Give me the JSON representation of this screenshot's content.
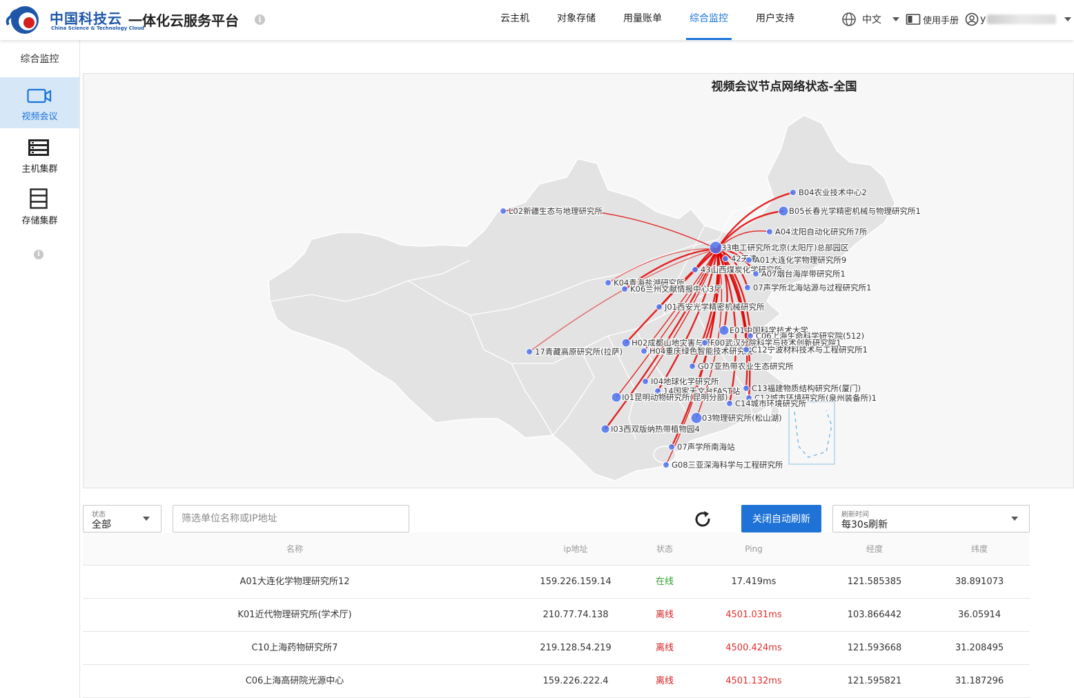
{
  "header": {
    "brand_cn": "中国科技云",
    "brand_en": "China Science & Technology Cloud",
    "platform_title": "一体化云服务平台",
    "nav": [
      {
        "label": "云主机",
        "active": false
      },
      {
        "label": "对象存储",
        "active": false
      },
      {
        "label": "用量账单",
        "active": false
      },
      {
        "label": "综合监控",
        "active": true
      },
      {
        "label": "用户支持",
        "active": false
      }
    ],
    "language": "中文",
    "manual": "使用手册",
    "user_initial": "y"
  },
  "sidebar": {
    "title": "综合监控",
    "items": [
      {
        "label": "视频会议",
        "icon": "video-icon",
        "active": true
      },
      {
        "label": "主机集群",
        "icon": "server-icon",
        "active": false
      },
      {
        "label": "存储集群",
        "icon": "storage-icon",
        "active": false
      }
    ]
  },
  "map": {
    "title": "视频会议节点网络状态-全国",
    "labels": [
      "L02新疆生态与地理研究所",
      "B04农业技术中心2",
      "B05长春光学精密机械与物理研究所1",
      "A04沈阳自动化研究所7所",
      "33电工研究所北京(太阳厅)总部园区",
      "42天津",
      "A01大连化学物理研究所9",
      "43山西煤炭化学研究所",
      "A07烟台海岸带研究所1",
      "K04青海盐湖研究所",
      "K06兰州文献情报中心3厅",
      "07声学所北海站源与过程研究所1",
      "J01西安光学精密机械研究所",
      "E01中国科学技术大学",
      "C06上海生命科学研究院(512)",
      "17青藏高原研究所(拉萨)",
      "H02成都山地灾害与环境研究所",
      "F00武汉分院科学与技术创新研究院1",
      "H04重庆绿色智能技术研究院",
      "C12宁波材料技术与工程研究所1",
      "G07亚热带农业生态研究所",
      "I04地球化学研究所",
      "14国家天文台FAST站",
      "C13福建物质结构研究所(厦门)",
      "I01昆明动物研究所(昆明分部)",
      "C12城市环境研究所(泉州装备所)1",
      "C14城市环境研究所",
      "03物理研究所(松山湖)",
      "I03西双版纳热带植物园4",
      "07声学所南海站",
      "G08三亚深海科学与工程研究所"
    ]
  },
  "filters": {
    "status_label": "状态",
    "status_value": "全部",
    "search_placeholder": "筛选单位名称或IP地址",
    "auto_refresh_button": "关闭自动刷新",
    "refresh_label": "刷新时间",
    "refresh_value": "每30s刷新"
  },
  "table": {
    "headers": {
      "name": "名称",
      "ip": "ip地址",
      "state": "状态",
      "ping": "Ping",
      "lng": "经度",
      "lat": "纬度"
    },
    "rows": [
      {
        "name": "A01大连化学物理研究所12",
        "ip": "159.226.159.14",
        "state": "在线",
        "ping": "17.419ms",
        "lng": "121.585385",
        "lat": "38.891073"
      },
      {
        "name": "K01近代物理研究所(学术厅)",
        "ip": "210.77.74.138",
        "state": "离线",
        "ping": "4501.031ms",
        "lng": "103.866442",
        "lat": "36.05914"
      },
      {
        "name": "C10上海药物研究所7",
        "ip": "219.128.54.219",
        "state": "离线",
        "ping": "4500.424ms",
        "lng": "121.593668",
        "lat": "31.208495"
      },
      {
        "name": "C06上海高研院光源中心",
        "ip": "159.226.222.4",
        "state": "离线",
        "ping": "4501.132ms",
        "lng": "121.595821",
        "lat": "31.187296"
      }
    ]
  },
  "colors": {
    "accent": "#1a73d9",
    "online": "#2ca02c",
    "offline": "#d62020",
    "line": "#e00000",
    "node": "#4f74f0"
  }
}
